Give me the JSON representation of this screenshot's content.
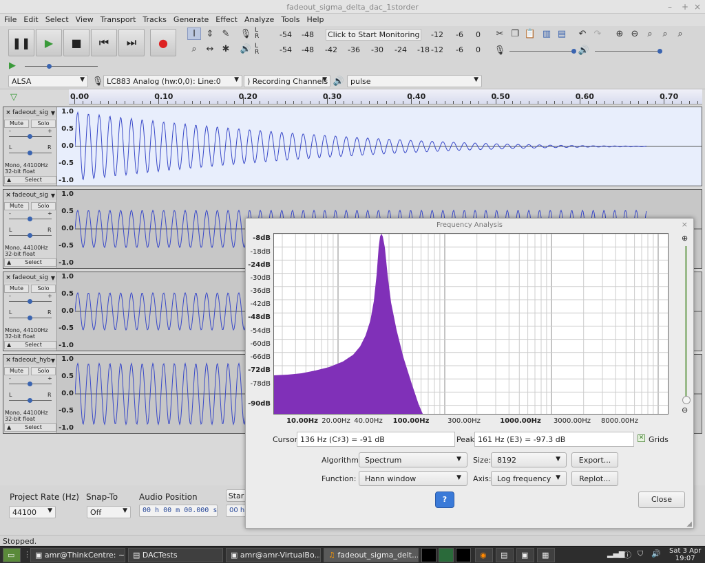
{
  "window": {
    "title": "fadeout_sigma_delta_dac_1storder"
  },
  "menu": [
    "File",
    "Edit",
    "Select",
    "View",
    "Transport",
    "Tracks",
    "Generate",
    "Effect",
    "Analyze",
    "Tools",
    "Help"
  ],
  "meters": {
    "monitor": "Click to Start Monitoring",
    "rec_left": [
      "-54",
      "-48"
    ],
    "rec_right": [
      "-12",
      "-6",
      "0"
    ],
    "play": [
      "-54",
      "-48",
      "-42",
      "-36",
      "-30",
      "-24",
      "-18",
      "-12",
      "-6",
      "0"
    ],
    "L": "L",
    "R": "R"
  },
  "devices": {
    "host": "ALSA",
    "mic": "LC883 Analog (hw:0,0): Line:0",
    "channels": ") Recording Channels",
    "speaker": "pulse"
  },
  "ruler": [
    "0.00",
    "0.10",
    "0.20",
    "0.30",
    "0.40",
    "0.50",
    "0.60",
    "0.70"
  ],
  "tracks": [
    {
      "name": "fadeout_sig",
      "info1": "Mono, 44100Hz",
      "info2": "32-bit float"
    },
    {
      "name": "fadeout_sig",
      "info1": "Mono, 44100Hz",
      "info2": "32-bit float"
    },
    {
      "name": "fadeout_sig",
      "info1": "Mono, 44100Hz",
      "info2": "32-bit float"
    },
    {
      "name": "fadeout_hyb",
      "info1": "Mono, 44100Hz",
      "info2": "32-bit float"
    }
  ],
  "track_labels": {
    "mute": "Mute",
    "solo": "Solo",
    "select": "Select",
    "close": "×",
    "minus": "-",
    "plus": "+",
    "L": "L",
    "R": "R"
  },
  "scale": [
    "1.0",
    "0.5",
    "0.0",
    "-0.5",
    "-1.0"
  ],
  "dialog": {
    "title": "Frequency Analysis",
    "y_labels": [
      "-8dB",
      "-18dB",
      "-24dB",
      "-30dB",
      "-36dB",
      "-42dB",
      "-48dB",
      "-54dB",
      "-60dB",
      "-66dB",
      "-72dB",
      "-78dB",
      "-90dB"
    ],
    "x_labels": [
      "10.00Hz",
      "20.00Hz",
      "40.00Hz",
      "100.00Hz",
      "300.00Hz",
      "1000.00Hz",
      "3000.00Hz",
      "8000.00Hz"
    ],
    "cursor_label": "Cursor:",
    "cursor_value": "136 Hz (C♯3) = -91 dB",
    "peak_label": "Peak:",
    "peak_value": "161 Hz (E3) = -97.3 dB",
    "grids": "Grids",
    "algorithm_label": "Algorithm:",
    "algorithm": "Spectrum",
    "size_label": "Size:",
    "size": "8192",
    "function_label": "Function:",
    "function": "Hann window",
    "axis_label": "Axis:",
    "axis": "Log frequency",
    "export": "Export...",
    "replot": "Replot...",
    "close": "Close",
    "help": "?",
    "fill_color": "#8030b8"
  },
  "bottom": {
    "rate_label": "Project Rate (Hz)",
    "rate": "44100",
    "snap_label": "Snap-To",
    "snap": "Off",
    "pos_label": "Audio Position",
    "pos": "00 h 00 m 00.000 s",
    "start_label": "Star",
    "pos2": "00 h"
  },
  "status": "Stopped.",
  "taskbar": [
    "amr@ThinkCentre: ~...",
    "DACTests",
    "amr@amr-VirtualBo...",
    "fadeout_sigma_delt..."
  ],
  "clock": {
    "date": "Sat 3 Apr",
    "time": "19:07"
  }
}
